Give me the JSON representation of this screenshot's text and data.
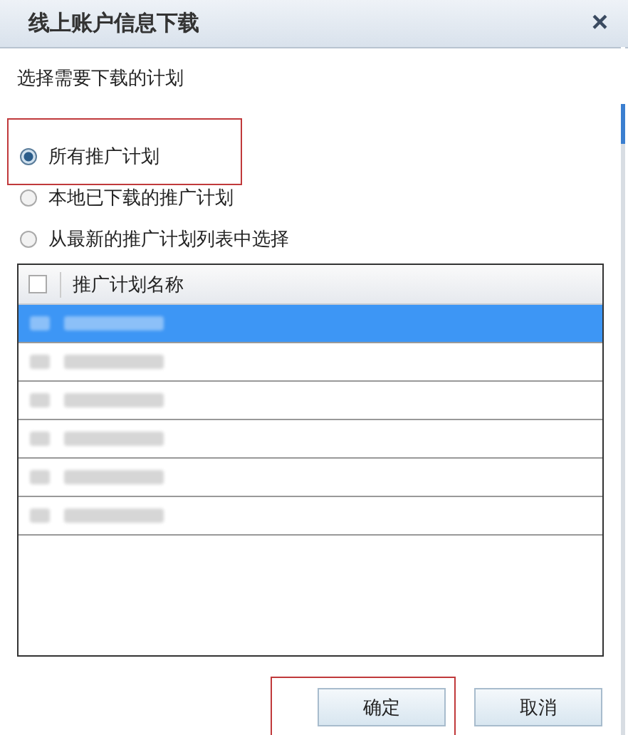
{
  "window": {
    "title": "线上账户信息下载",
    "close": "×"
  },
  "prompt": "选择需要下载的计划",
  "options": [
    {
      "label": "所有推广计划",
      "selected": true,
      "highlighted": true
    },
    {
      "label": "本地已下载的推广计划",
      "selected": false,
      "highlighted": false
    },
    {
      "label": "从最新的推广计划列表中选择",
      "selected": false,
      "highlighted": false
    }
  ],
  "table": {
    "header_checked": false,
    "column": "推广计划名称",
    "rows": [
      {
        "selected": true
      },
      {
        "selected": false
      },
      {
        "selected": false
      },
      {
        "selected": false
      },
      {
        "selected": false
      },
      {
        "selected": false
      }
    ]
  },
  "buttons": [
    {
      "label": "确定",
      "highlighted": true
    },
    {
      "label": "取消",
      "highlighted": false
    }
  ]
}
